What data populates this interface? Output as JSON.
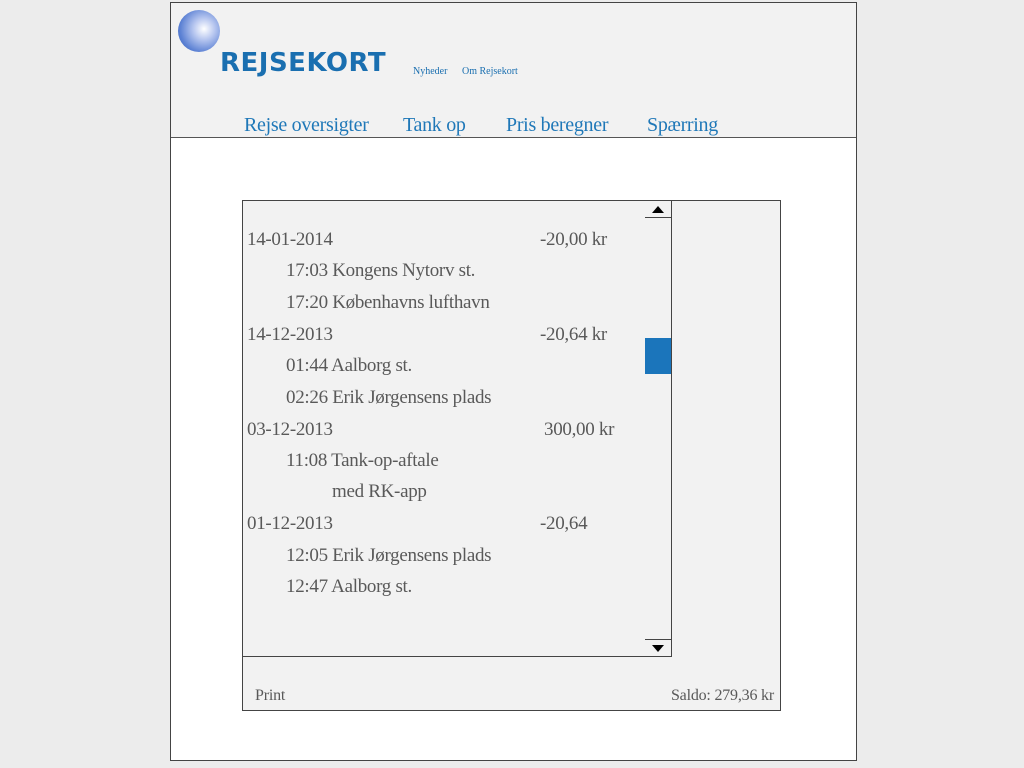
{
  "brand": {
    "name": "REJSEKORT"
  },
  "top_links": [
    "Nyheder",
    "Om Rejsekort"
  ],
  "nav": [
    "Rejse oversigter",
    "Tank op",
    "Pris beregner",
    "Spærring"
  ],
  "transactions": [
    {
      "date": "14-01-2014",
      "amount": "-20,00 kr",
      "entries": [
        "17:03 Kongens Nytorv st.",
        "17:20 Københavns lufthavn"
      ]
    },
    {
      "date": "14-12-2013",
      "amount": "-20,64 kr",
      "entries": [
        "01:44 Aalborg st.",
        "02:26 Erik Jørgensens plads"
      ]
    },
    {
      "date": "03-12-2013",
      "amount": "300,00 kr",
      "entries": [
        "11:08 Tank-op-aftale",
        "med RK-app"
      ]
    },
    {
      "date": "01-12-2013",
      "amount": "-20,64",
      "entries": [
        "12:05 Erik Jørgensens plads",
        "12:47 Aalborg st."
      ]
    }
  ],
  "footer": {
    "print": "Print",
    "balance": "Saldo: 279,36 kr"
  },
  "colors": {
    "brand_blue": "#1a6fb0",
    "nav_blue": "#1f78b8",
    "scroll_thumb": "#1b75bb",
    "panel_bg": "#f2f2f2",
    "text_grey": "#595959"
  }
}
